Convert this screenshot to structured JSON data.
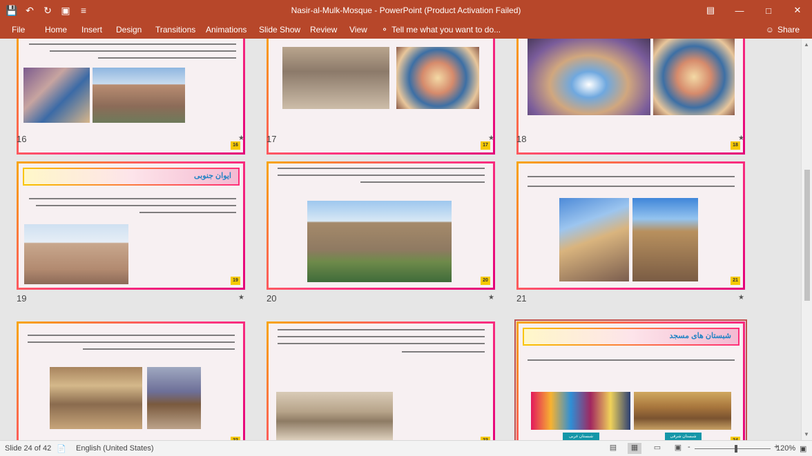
{
  "window": {
    "title": "Nasir-al-Mulk-Mosque - PowerPoint (Product Activation Failed)",
    "qat_icons": [
      "save-icon",
      "undo-icon",
      "redo-icon",
      "slideshow-icon",
      "customize-icon"
    ],
    "control_icons": [
      "ribbon-display-icon",
      "minimize-icon",
      "maximize-icon",
      "close-icon"
    ]
  },
  "ribbon": {
    "tabs": [
      "File",
      "Home",
      "Insert",
      "Design",
      "Transitions",
      "Animations",
      "Slide Show",
      "Review",
      "View"
    ],
    "tell_me": "Tell me what you want to do...",
    "share": "Share"
  },
  "slides": [
    {
      "number": "16",
      "label": "16",
      "title": ""
    },
    {
      "number": "17",
      "label": "17",
      "title": ""
    },
    {
      "number": "18",
      "label": "18",
      "title": ""
    },
    {
      "number": "19",
      "label": "19",
      "title": "ایوان جنوبی"
    },
    {
      "number": "20",
      "label": "20",
      "title": ""
    },
    {
      "number": "21",
      "label": "21",
      "title": ""
    },
    {
      "number": "22",
      "label": "22",
      "title": ""
    },
    {
      "number": "23",
      "label": "23",
      "title": ""
    },
    {
      "number": "24",
      "label": "24",
      "title": "شبستان های مسجد",
      "captions": [
        "شبستان غربی",
        "شبستان شرقی"
      ]
    }
  ],
  "status": {
    "slide_count": "Slide 24 of 42",
    "language": "English (United States)",
    "zoom": "120%",
    "zoom_minus": "-",
    "zoom_plus": "+"
  }
}
